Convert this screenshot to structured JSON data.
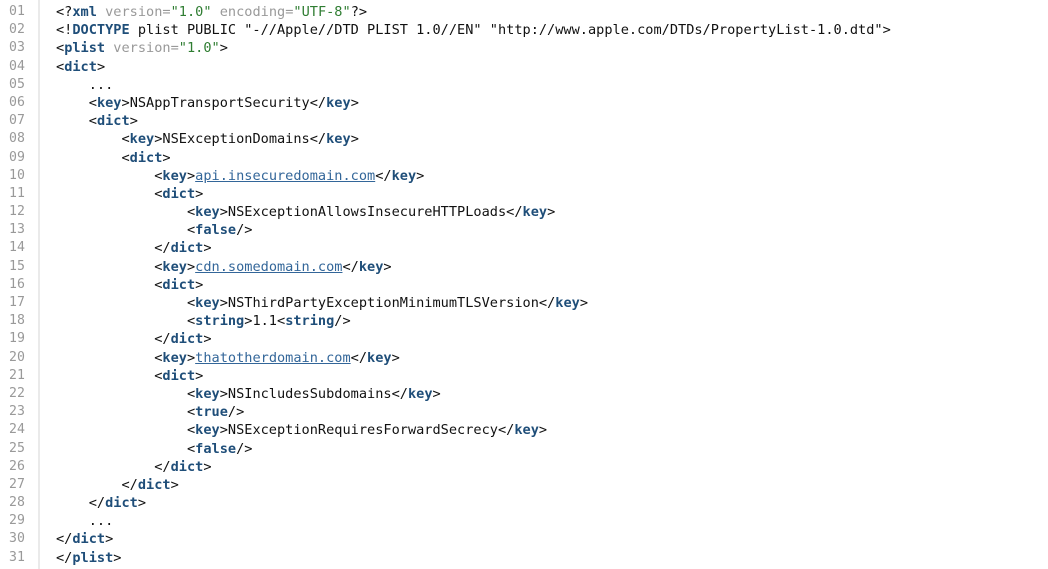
{
  "lines": [
    {
      "num": "01",
      "indent": 0,
      "tokens": [
        {
          "t": "punct",
          "v": "<?"
        },
        {
          "t": "tag",
          "v": "xml"
        },
        {
          "t": "text",
          "v": " "
        },
        {
          "t": "attr",
          "v": "version="
        },
        {
          "t": "str",
          "v": "\"1.0\""
        },
        {
          "t": "text",
          "v": " "
        },
        {
          "t": "attr",
          "v": "encoding="
        },
        {
          "t": "str",
          "v": "\"UTF-8\""
        },
        {
          "t": "punct",
          "v": "?>"
        }
      ]
    },
    {
      "num": "02",
      "indent": 0,
      "tokens": [
        {
          "t": "punct",
          "v": "<!"
        },
        {
          "t": "tag",
          "v": "DOCTYPE"
        },
        {
          "t": "doctype",
          "v": " plist PUBLIC \"-//Apple//DTD PLIST 1.0//EN\" \"http://www.apple.com/DTDs/PropertyList-1.0.dtd\""
        },
        {
          "t": "punct",
          "v": ">"
        }
      ]
    },
    {
      "num": "03",
      "indent": 0,
      "tokens": [
        {
          "t": "punct",
          "v": "<"
        },
        {
          "t": "tag",
          "v": "plist"
        },
        {
          "t": "text",
          "v": " "
        },
        {
          "t": "attr",
          "v": "version="
        },
        {
          "t": "str",
          "v": "\"1.0\""
        },
        {
          "t": "punct",
          "v": ">"
        }
      ]
    },
    {
      "num": "04",
      "indent": 0,
      "tokens": [
        {
          "t": "punct",
          "v": "<"
        },
        {
          "t": "tag",
          "v": "dict"
        },
        {
          "t": "punct",
          "v": ">"
        }
      ]
    },
    {
      "num": "05",
      "indent": 1,
      "tokens": [
        {
          "t": "text",
          "v": "..."
        }
      ]
    },
    {
      "num": "06",
      "indent": 1,
      "tokens": [
        {
          "t": "punct",
          "v": "<"
        },
        {
          "t": "tag",
          "v": "key"
        },
        {
          "t": "punct",
          "v": ">"
        },
        {
          "t": "text",
          "v": "NSAppTransportSecurity"
        },
        {
          "t": "punct",
          "v": "</"
        },
        {
          "t": "tag",
          "v": "key"
        },
        {
          "t": "punct",
          "v": ">"
        }
      ]
    },
    {
      "num": "07",
      "indent": 1,
      "tokens": [
        {
          "t": "punct",
          "v": "<"
        },
        {
          "t": "tag",
          "v": "dict"
        },
        {
          "t": "punct",
          "v": ">"
        }
      ]
    },
    {
      "num": "08",
      "indent": 2,
      "tokens": [
        {
          "t": "punct",
          "v": "<"
        },
        {
          "t": "tag",
          "v": "key"
        },
        {
          "t": "punct",
          "v": ">"
        },
        {
          "t": "text",
          "v": "NSExceptionDomains"
        },
        {
          "t": "punct",
          "v": "</"
        },
        {
          "t": "tag",
          "v": "key"
        },
        {
          "t": "punct",
          "v": ">"
        }
      ]
    },
    {
      "num": "09",
      "indent": 2,
      "tokens": [
        {
          "t": "punct",
          "v": "<"
        },
        {
          "t": "tag",
          "v": "dict"
        },
        {
          "t": "punct",
          "v": ">"
        }
      ]
    },
    {
      "num": "10",
      "indent": 3,
      "tokens": [
        {
          "t": "punct",
          "v": "<"
        },
        {
          "t": "tag",
          "v": "key"
        },
        {
          "t": "punct",
          "v": ">"
        },
        {
          "t": "link",
          "v": "api.insecuredomain.com"
        },
        {
          "t": "punct",
          "v": "</"
        },
        {
          "t": "tag",
          "v": "key"
        },
        {
          "t": "punct",
          "v": ">"
        }
      ]
    },
    {
      "num": "11",
      "indent": 3,
      "tokens": [
        {
          "t": "punct",
          "v": "<"
        },
        {
          "t": "tag",
          "v": "dict"
        },
        {
          "t": "punct",
          "v": ">"
        }
      ]
    },
    {
      "num": "12",
      "indent": 4,
      "tokens": [
        {
          "t": "punct",
          "v": "<"
        },
        {
          "t": "tag",
          "v": "key"
        },
        {
          "t": "punct",
          "v": ">"
        },
        {
          "t": "text",
          "v": "NSExceptionAllowsInsecureHTTPLoads"
        },
        {
          "t": "punct",
          "v": "</"
        },
        {
          "t": "tag",
          "v": "key"
        },
        {
          "t": "punct",
          "v": ">"
        }
      ]
    },
    {
      "num": "13",
      "indent": 4,
      "tokens": [
        {
          "t": "punct",
          "v": "<"
        },
        {
          "t": "tag",
          "v": "false"
        },
        {
          "t": "punct",
          "v": "/>"
        }
      ]
    },
    {
      "num": "14",
      "indent": 3,
      "tokens": [
        {
          "t": "punct",
          "v": "</"
        },
        {
          "t": "tag",
          "v": "dict"
        },
        {
          "t": "punct",
          "v": ">"
        }
      ]
    },
    {
      "num": "15",
      "indent": 3,
      "tokens": [
        {
          "t": "punct",
          "v": "<"
        },
        {
          "t": "tag",
          "v": "key"
        },
        {
          "t": "punct",
          "v": ">"
        },
        {
          "t": "link",
          "v": "cdn.somedomain.com"
        },
        {
          "t": "punct",
          "v": "</"
        },
        {
          "t": "tag",
          "v": "key"
        },
        {
          "t": "punct",
          "v": ">"
        }
      ]
    },
    {
      "num": "16",
      "indent": 3,
      "tokens": [
        {
          "t": "punct",
          "v": "<"
        },
        {
          "t": "tag",
          "v": "dict"
        },
        {
          "t": "punct",
          "v": ">"
        }
      ]
    },
    {
      "num": "17",
      "indent": 4,
      "tokens": [
        {
          "t": "punct",
          "v": "<"
        },
        {
          "t": "tag",
          "v": "key"
        },
        {
          "t": "punct",
          "v": ">"
        },
        {
          "t": "text",
          "v": "NSThirdPartyExceptionMinimumTLSVersion"
        },
        {
          "t": "punct",
          "v": "</"
        },
        {
          "t": "tag",
          "v": "key"
        },
        {
          "t": "punct",
          "v": ">"
        }
      ]
    },
    {
      "num": "18",
      "indent": 4,
      "tokens": [
        {
          "t": "punct",
          "v": "<"
        },
        {
          "t": "tag",
          "v": "string"
        },
        {
          "t": "punct",
          "v": ">"
        },
        {
          "t": "text",
          "v": "1.1"
        },
        {
          "t": "punct",
          "v": "<"
        },
        {
          "t": "tag",
          "v": "string"
        },
        {
          "t": "punct",
          "v": "/>"
        }
      ]
    },
    {
      "num": "19",
      "indent": 3,
      "tokens": [
        {
          "t": "punct",
          "v": "</"
        },
        {
          "t": "tag",
          "v": "dict"
        },
        {
          "t": "punct",
          "v": ">"
        }
      ]
    },
    {
      "num": "20",
      "indent": 3,
      "tokens": [
        {
          "t": "punct",
          "v": "<"
        },
        {
          "t": "tag",
          "v": "key"
        },
        {
          "t": "punct",
          "v": ">"
        },
        {
          "t": "link",
          "v": "thatotherdomain.com"
        },
        {
          "t": "punct",
          "v": "</"
        },
        {
          "t": "tag",
          "v": "key"
        },
        {
          "t": "punct",
          "v": ">"
        }
      ]
    },
    {
      "num": "21",
      "indent": 3,
      "tokens": [
        {
          "t": "punct",
          "v": "<"
        },
        {
          "t": "tag",
          "v": "dict"
        },
        {
          "t": "punct",
          "v": ">"
        }
      ]
    },
    {
      "num": "22",
      "indent": 4,
      "tokens": [
        {
          "t": "punct",
          "v": "<"
        },
        {
          "t": "tag",
          "v": "key"
        },
        {
          "t": "punct",
          "v": ">"
        },
        {
          "t": "text",
          "v": "NSIncludesSubdomains"
        },
        {
          "t": "punct",
          "v": "</"
        },
        {
          "t": "tag",
          "v": "key"
        },
        {
          "t": "punct",
          "v": ">"
        }
      ]
    },
    {
      "num": "23",
      "indent": 4,
      "tokens": [
        {
          "t": "punct",
          "v": "<"
        },
        {
          "t": "tag",
          "v": "true"
        },
        {
          "t": "punct",
          "v": "/>"
        }
      ]
    },
    {
      "num": "24",
      "indent": 4,
      "tokens": [
        {
          "t": "punct",
          "v": "<"
        },
        {
          "t": "tag",
          "v": "key"
        },
        {
          "t": "punct",
          "v": ">"
        },
        {
          "t": "text",
          "v": "NSExceptionRequiresForwardSecrecy"
        },
        {
          "t": "punct",
          "v": "</"
        },
        {
          "t": "tag",
          "v": "key"
        },
        {
          "t": "punct",
          "v": ">"
        }
      ]
    },
    {
      "num": "25",
      "indent": 4,
      "tokens": [
        {
          "t": "punct",
          "v": "<"
        },
        {
          "t": "tag",
          "v": "false"
        },
        {
          "t": "punct",
          "v": "/>"
        }
      ]
    },
    {
      "num": "26",
      "indent": 3,
      "tokens": [
        {
          "t": "punct",
          "v": "</"
        },
        {
          "t": "tag",
          "v": "dict"
        },
        {
          "t": "punct",
          "v": ">"
        }
      ]
    },
    {
      "num": "27",
      "indent": 2,
      "tokens": [
        {
          "t": "punct",
          "v": "</"
        },
        {
          "t": "tag",
          "v": "dict"
        },
        {
          "t": "punct",
          "v": ">"
        }
      ]
    },
    {
      "num": "28",
      "indent": 1,
      "tokens": [
        {
          "t": "punct",
          "v": "</"
        },
        {
          "t": "tag",
          "v": "dict"
        },
        {
          "t": "punct",
          "v": ">"
        }
      ]
    },
    {
      "num": "29",
      "indent": 1,
      "tokens": [
        {
          "t": "text",
          "v": "..."
        }
      ]
    },
    {
      "num": "30",
      "indent": 0,
      "tokens": [
        {
          "t": "punct",
          "v": "</"
        },
        {
          "t": "tag",
          "v": "dict"
        },
        {
          "t": "punct",
          "v": ">"
        }
      ]
    },
    {
      "num": "31",
      "indent": 0,
      "tokens": [
        {
          "t": "punct",
          "v": "</"
        },
        {
          "t": "tag",
          "v": "plist"
        },
        {
          "t": "punct",
          "v": ">"
        }
      ]
    }
  ],
  "colors": {
    "tag": "#1f4e79",
    "attr": "#999999",
    "string": "#2f7d32",
    "link": "#336699",
    "line_number": "#999999",
    "gutter_border": "#eaeaea"
  }
}
